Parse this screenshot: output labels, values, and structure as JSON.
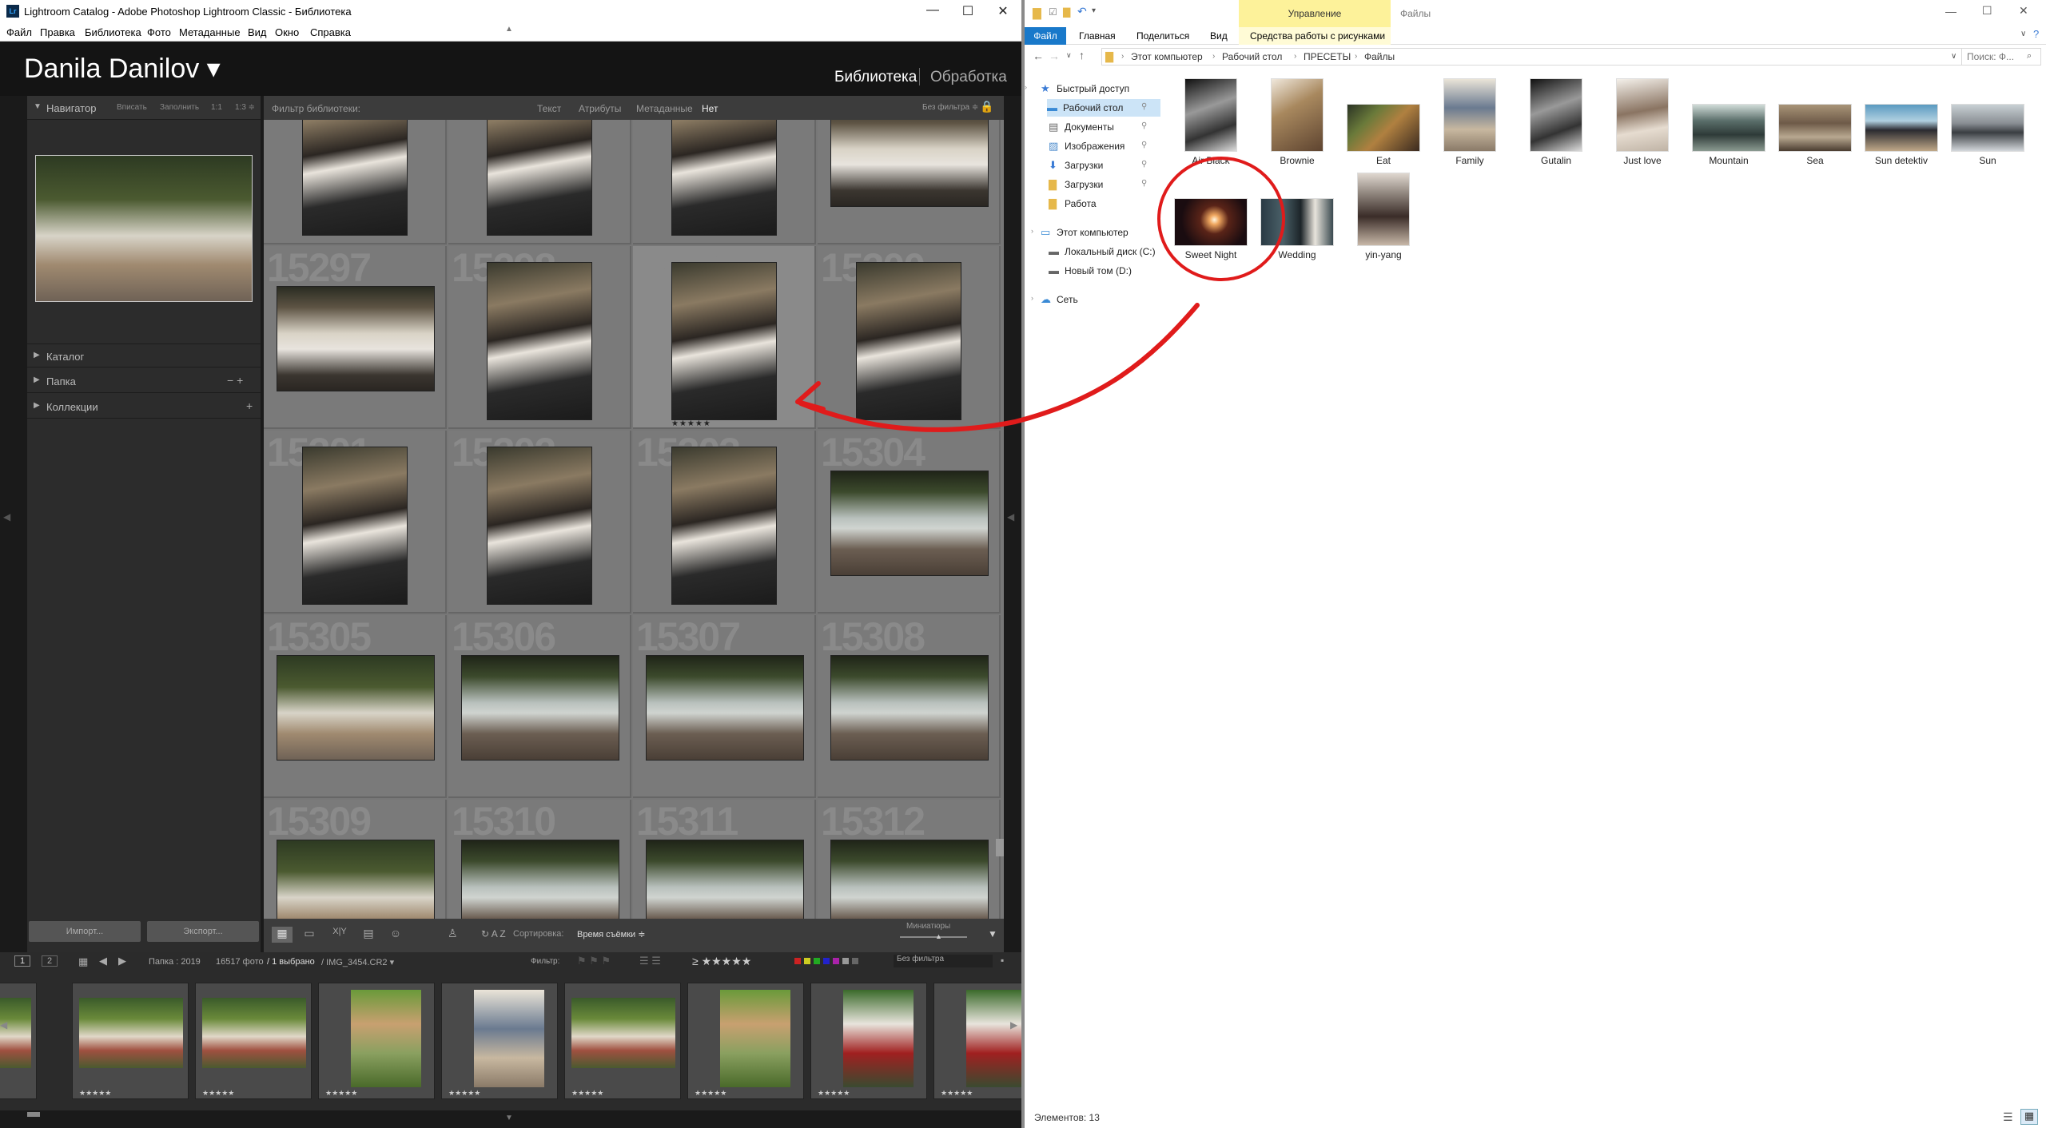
{
  "lightroom": {
    "window_title": "Lightroom Catalog - Adobe Photoshop Lightroom Classic - Библиотека",
    "logo": "Lr",
    "menu": [
      "Файл",
      "Правка",
      "Библиотека",
      "Фото",
      "Метаданные",
      "Вид",
      "Окно",
      "Справка"
    ],
    "identity_plate": "Danila Danilov ▾",
    "modules": {
      "library": "Библиотека",
      "develop": "Обработка"
    },
    "navigator": {
      "title": "Навигатор",
      "options": [
        "Вписать",
        "Заполнить",
        "1:1",
        "1:3 ≑"
      ]
    },
    "panels": [
      {
        "label": "Каталог",
        "buttons": ""
      },
      {
        "label": "Папка",
        "buttons": "−  +"
      },
      {
        "label": "Коллекции",
        "buttons": "+"
      }
    ],
    "import_button": "Импорт...",
    "export_button": "Экспорт...",
    "filter_bar": {
      "title": "Фильтр библиотеки:",
      "options": [
        "Текст",
        "Атрибуты",
        "Метаданные",
        "Нет"
      ],
      "active": "Нет",
      "preset": "Без фильтра ≑"
    },
    "grid_cells": [
      {
        "num": "",
        "photo": "p-couple",
        "orient": "portrait"
      },
      {
        "num": "",
        "photo": "p-couple",
        "orient": "portrait"
      },
      {
        "num": "",
        "photo": "p-couple",
        "orient": "portrait"
      },
      {
        "num": "",
        "photo": "p-couple2",
        "orient": "landscape"
      },
      {
        "num": "15297",
        "photo": "p-couple2",
        "orient": "landscape"
      },
      {
        "num": "15298",
        "photo": "p-couple",
        "orient": "portrait"
      },
      {
        "num": "15299",
        "photo": "p-couple",
        "orient": "portrait",
        "stars": "★★★★★",
        "selected": true
      },
      {
        "num": "15300",
        "photo": "p-couple",
        "orient": "portrait"
      },
      {
        "num": "15301",
        "photo": "p-couple",
        "orient": "portrait"
      },
      {
        "num": "15302",
        "photo": "p-couple",
        "orient": "portrait"
      },
      {
        "num": "15303",
        "photo": "p-couple",
        "orient": "portrait"
      },
      {
        "num": "15304",
        "photo": "p-dock",
        "orient": "landscape"
      },
      {
        "num": "15305",
        "photo": "p-park",
        "orient": "landscape"
      },
      {
        "num": "15306",
        "photo": "p-dock",
        "orient": "landscape"
      },
      {
        "num": "15307",
        "photo": "p-dock",
        "orient": "landscape"
      },
      {
        "num": "15308",
        "photo": "p-dock",
        "orient": "landscape"
      },
      {
        "num": "15309",
        "photo": "p-park",
        "orient": "landscape"
      },
      {
        "num": "15310",
        "photo": "p-dock",
        "orient": "landscape"
      },
      {
        "num": "15311",
        "photo": "p-dock",
        "orient": "landscape"
      },
      {
        "num": "15312",
        "photo": "p-dock",
        "orient": "landscape"
      }
    ],
    "toolbar": {
      "sort_label": "Сортировка:",
      "sort_value": "Время съёмки ≑",
      "thumbs_label": "Миниатюры"
    },
    "filmstrip_info": {
      "screen1": "1",
      "screen2": "2",
      "path": "Папка : 2019",
      "count": "16517 фото",
      "selected": "/ 1 выбрано",
      "file": "/ IMG_3454.CR2 ▾",
      "filter_label": "Фильтр:",
      "preset": "Без фильтра"
    },
    "filmstrip": [
      {
        "photo": "p-picnic",
        "stars": ""
      },
      {
        "photo": "p-picnic",
        "stars": "★★★★★"
      },
      {
        "photo": "p-picnic",
        "stars": "★★★★★"
      },
      {
        "photo": "p-green",
        "stars": "★★★★★"
      },
      {
        "photo": "p-family",
        "stars": "★★★★★"
      },
      {
        "photo": "p-picnic",
        "stars": "★★★★★"
      },
      {
        "photo": "p-green",
        "stars": "★★★★★"
      },
      {
        "photo": "p-car",
        "stars": "★★★★★"
      },
      {
        "photo": "p-car",
        "stars": "★★★★★"
      }
    ]
  },
  "explorer": {
    "manage_tab": "Управление",
    "window_title": "Файлы",
    "ribbon": [
      "Файл",
      "Главная",
      "Поделиться",
      "Вид",
      "Средства работы с рисунками"
    ],
    "breadcrumbs": [
      "Этот компьютер",
      "Рабочий стол",
      "ПРЕСЕТЫ",
      "Файлы"
    ],
    "search_placeholder": "Поиск: Ф...",
    "nav": [
      {
        "label": "Быстрый доступ",
        "icon": "star-icon",
        "indent": 0
      },
      {
        "label": "Рабочий стол",
        "icon": "desktop-icon",
        "indent": 1,
        "pinned": true,
        "selected": true
      },
      {
        "label": "Документы",
        "icon": "document-icon",
        "indent": 1,
        "pinned": true
      },
      {
        "label": "Изображения",
        "icon": "image-icon",
        "indent": 1,
        "pinned": true
      },
      {
        "label": "Загрузки",
        "icon": "download-icon",
        "indent": 1,
        "pinned": true
      },
      {
        "label": "Загрузки",
        "icon": "folder-icon",
        "indent": 1,
        "pinned": true
      },
      {
        "label": "Работа",
        "icon": "folder-icon",
        "indent": 1
      },
      {
        "label": "Этот компьютер",
        "icon": "computer-icon",
        "indent": 0
      },
      {
        "label": "Локальный диск (C:)",
        "icon": "drive-icon",
        "indent": 1
      },
      {
        "label": "Новый том (D:)",
        "icon": "drive-icon",
        "indent": 1
      },
      {
        "label": "Сеть",
        "icon": "network-icon",
        "indent": 0
      }
    ],
    "files": [
      {
        "name": "Air Black",
        "photo": "p-bw",
        "orient": "portrait"
      },
      {
        "name": "Brownie",
        "photo": "p-coffee",
        "orient": "portrait"
      },
      {
        "name": "Eat",
        "photo": "p-food",
        "orient": "landscape"
      },
      {
        "name": "Family",
        "photo": "p-family",
        "orient": "portrait"
      },
      {
        "name": "Gutalin",
        "photo": "p-bw",
        "orient": "portrait"
      },
      {
        "name": "Just love",
        "photo": "p-hat",
        "orient": "portrait"
      },
      {
        "name": "Mountain",
        "photo": "p-mountain",
        "orient": "landscape"
      },
      {
        "name": "Sea",
        "photo": "p-sea",
        "orient": "landscape"
      },
      {
        "name": "Sun detektiv",
        "photo": "p-sun",
        "orient": "landscape"
      },
      {
        "name": "Sun",
        "photo": "p-deck",
        "orient": "landscape"
      },
      {
        "name": "Sweet Night",
        "photo": "p-night",
        "orient": "landscape"
      },
      {
        "name": "Wedding",
        "photo": "p-wed",
        "orient": "landscape"
      },
      {
        "name": "yin-yang",
        "photo": "p-yin",
        "orient": "portrait"
      }
    ],
    "status": "Элементов: 13"
  },
  "annotation_color": "#e01b1b"
}
